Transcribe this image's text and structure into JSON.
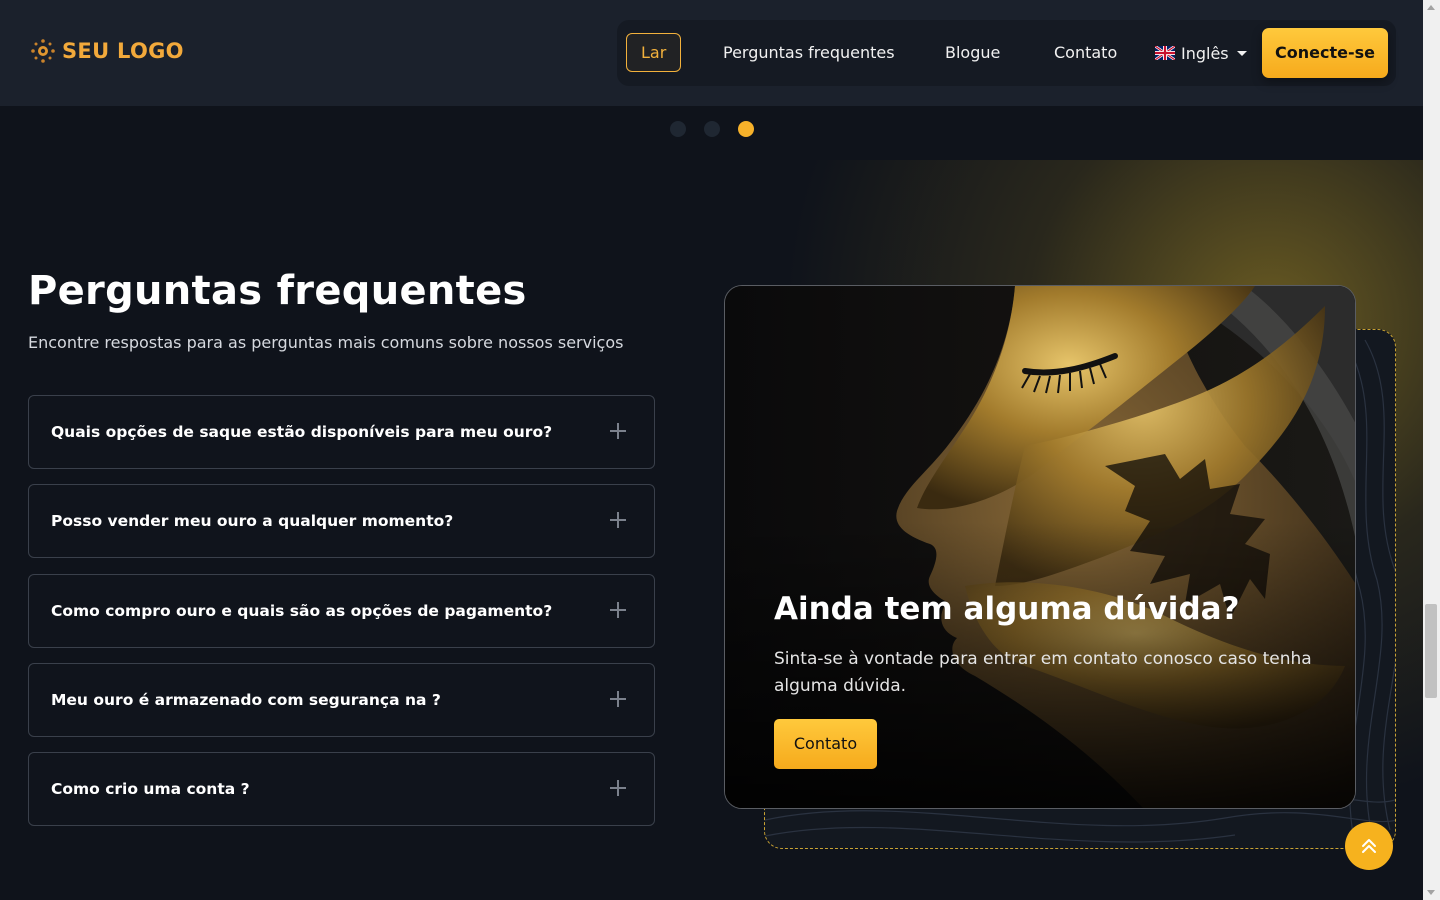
{
  "header": {
    "logo_text": "SEU LOGO",
    "nav": [
      {
        "label": "Lar",
        "active": true
      },
      {
        "label": "Perguntas frequentes",
        "active": false
      },
      {
        "label": "Blogue",
        "active": false
      },
      {
        "label": "Contato",
        "active": false
      }
    ],
    "language": {
      "label": "Inglês",
      "flag_icon": "uk-flag-icon"
    },
    "connect_label": "Conecte-se"
  },
  "carousel": {
    "dot_count": 3,
    "active_index": 2
  },
  "faq": {
    "title": "Perguntas frequentes",
    "subtitle": "Encontre respostas para as perguntas mais comuns sobre nossos serviços",
    "items": [
      {
        "question": "Quais opções de saque estão disponíveis para meu ouro?"
      },
      {
        "question": "Posso vender meu ouro a qualquer momento?"
      },
      {
        "question": "Como compro ouro e quais são as opções de pagamento?"
      },
      {
        "question": "Meu ouro é armazenado com segurança na ?"
      },
      {
        "question": "Como crio uma conta ?"
      }
    ],
    "expand_icon": "plus-icon"
  },
  "contact_card": {
    "title": "Ainda tem alguma dúvida?",
    "text": "Sinta-se à vontade para entrar em contato conosco caso tenha alguma dúvida.",
    "button_label": "Contato"
  },
  "colors": {
    "accent": "#f6b21e",
    "background": "#0f131b",
    "header_bg": "#1b212c"
  },
  "back_to_top_icon": "double-chevron-up-icon"
}
